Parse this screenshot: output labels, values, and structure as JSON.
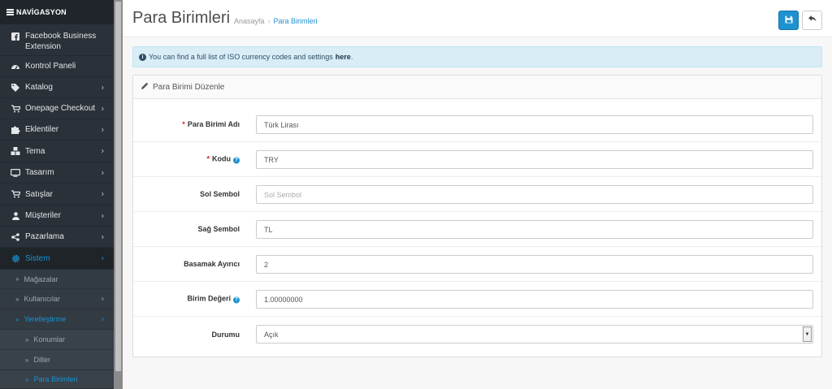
{
  "sidebar": {
    "nav_title": "NAVİGASYON",
    "menu": [
      {
        "label": "Facebook Business Extension",
        "icon": "facebook-square-icon"
      },
      {
        "label": "Kontrol Paneli",
        "icon": "dashboard-icon"
      },
      {
        "label": "Katalog",
        "icon": "tags-icon",
        "chevron": "›"
      },
      {
        "label": "Onepage Checkout",
        "icon": "cart-icon",
        "chevron": "›"
      },
      {
        "label": "Eklentiler",
        "icon": "puzzle-icon",
        "chevron": "›"
      },
      {
        "label": "Tema",
        "icon": "cubes-icon",
        "chevron": "›"
      },
      {
        "label": "Tasarım",
        "icon": "monitor-icon",
        "chevron": "›"
      },
      {
        "label": "Satışlar",
        "icon": "cart-icon",
        "chevron": "›"
      },
      {
        "label": "Müşteriler",
        "icon": "user-icon",
        "chevron": "›"
      },
      {
        "label": "Pazarlama",
        "icon": "share-icon",
        "chevron": "›"
      },
      {
        "label": "Sistem",
        "icon": "gear-icon",
        "chevron": "›"
      }
    ],
    "submenu": [
      {
        "label": "Mağazalar",
        "arrow": "»"
      },
      {
        "label": "Kullanıcılar",
        "arrow": "»",
        "chevron": "›"
      },
      {
        "label": "Yerelleştirme",
        "arrow": "»",
        "chevron": "›"
      },
      {
        "label": "Konumlar",
        "arrow": "»"
      },
      {
        "label": "Diller",
        "arrow": "»"
      },
      {
        "label": "Para Birimleri",
        "arrow": "»"
      }
    ]
  },
  "header": {
    "title": "Para Birimleri",
    "breadcrumb": [
      "Anasayfa",
      "Para Birimleri"
    ],
    "breadcrumb_sep": "›"
  },
  "alert": {
    "text": "You can find a full list of ISO currency codes and settings",
    "link": "here",
    "suffix": "."
  },
  "panel": {
    "title": "Para Birimi Düzenle"
  },
  "form": {
    "required_mark": "*",
    "help_mark": "?",
    "fields": [
      {
        "label": "Para Birimi Adı",
        "value": "Türk Lirası",
        "placeholder": "Para Birimi Adı",
        "required": true
      },
      {
        "label": "Kodu",
        "value": "TRY",
        "placeholder": "Kodu",
        "required": true,
        "help": true
      },
      {
        "label": "Sol Sembol",
        "value": "",
        "placeholder": "Sol Sembol"
      },
      {
        "label": "Sağ Sembol",
        "value": "TL",
        "placeholder": "Sağ Sembol"
      },
      {
        "label": "Basamak Ayırıcı",
        "value": "2",
        "placeholder": "Basamak Ayırıcı"
      },
      {
        "label": "Birim Değeri",
        "value": "1.00000000",
        "placeholder": "Birim Değeri",
        "help": true
      },
      {
        "label": "Durumu",
        "value": "Açık",
        "type": "select"
      }
    ]
  },
  "colors": {
    "accent": "#1e91cf",
    "sidebar_bg": "#2a3139",
    "required": "#e02222",
    "alert_bg": "#d9edf7"
  }
}
